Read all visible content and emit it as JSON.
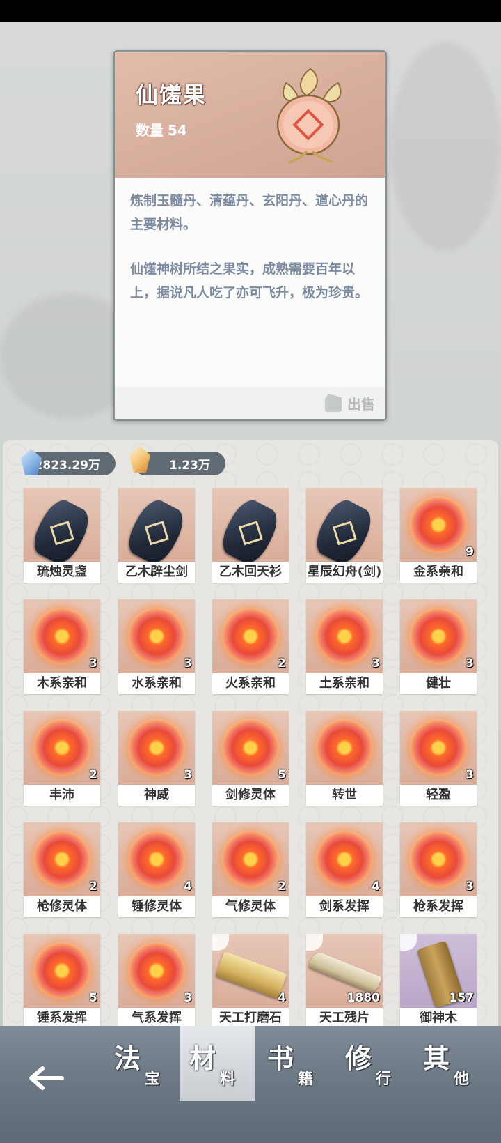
{
  "item_detail": {
    "name": "仙馐果",
    "quantity_label": "数量",
    "quantity_value": "54",
    "description_usage": "炼制玉髓丹、清蕴丹、玄阳丹、道心丹的主要材料。",
    "description_lore": "仙馐神树所结之果实，成熟需要百年以上，据说凡人吃了亦可飞升，极为珍贵。",
    "sell_label": "出售"
  },
  "currencies": [
    {
      "icon": "blue-crystal-icon",
      "value": "2823.29万",
      "color": "#8fb8e8"
    },
    {
      "icon": "gold-crystal-icon",
      "value": "1.23万",
      "color": "#f3c77a"
    }
  ],
  "inventory": [
    {
      "label": "琉烛灵盏",
      "icon": "black-rune-stone-icon",
      "count": ""
    },
    {
      "label": "乙木辟尘剑",
      "icon": "black-rune-stone-icon",
      "count": ""
    },
    {
      "label": "乙木回天衫",
      "icon": "black-rune-stone-icon",
      "count": ""
    },
    {
      "label": "星辰幻舟(剑)",
      "icon": "black-rune-stone-icon",
      "count": ""
    },
    {
      "label": "金系亲和",
      "icon": "fire-orb-icon",
      "count": "9"
    },
    {
      "label": "木系亲和",
      "icon": "fire-orb-icon",
      "count": "3"
    },
    {
      "label": "水系亲和",
      "icon": "fire-orb-icon",
      "count": "3"
    },
    {
      "label": "火系亲和",
      "icon": "fire-orb-icon",
      "count": "2"
    },
    {
      "label": "土系亲和",
      "icon": "fire-orb-icon",
      "count": "3"
    },
    {
      "label": "健壮",
      "icon": "fire-orb-icon",
      "count": "3"
    },
    {
      "label": "丰沛",
      "icon": "fire-orb-icon",
      "count": "2"
    },
    {
      "label": "神威",
      "icon": "fire-orb-icon",
      "count": "3"
    },
    {
      "label": "剑修灵体",
      "icon": "fire-orb-icon",
      "count": "5"
    },
    {
      "label": "转世",
      "icon": "fire-orb-icon",
      "count": ""
    },
    {
      "label": "轻盈",
      "icon": "fire-orb-icon",
      "count": "3"
    },
    {
      "label": "枪修灵体",
      "icon": "fire-orb-icon",
      "count": "2"
    },
    {
      "label": "锤修灵体",
      "icon": "fire-orb-icon",
      "count": "4"
    },
    {
      "label": "气修灵体",
      "icon": "fire-orb-icon",
      "count": "2"
    },
    {
      "label": "剑系发挥",
      "icon": "fire-orb-icon",
      "count": "4"
    },
    {
      "label": "枪系发挥",
      "icon": "fire-orb-icon",
      "count": "3"
    },
    {
      "label": "锤系发挥",
      "icon": "fire-orb-icon",
      "count": "5"
    },
    {
      "label": "气系发挥",
      "icon": "fire-orb-icon",
      "count": "3"
    },
    {
      "label": "天工打磨石",
      "icon": "gold-whetstone-icon",
      "count": "4"
    },
    {
      "label": "天工残片",
      "icon": "bone-shard-icon",
      "count": "1880"
    },
    {
      "label": "御神木",
      "icon": "divine-wood-icon",
      "count": "157"
    }
  ],
  "nav": {
    "back_icon": "back-arrow-icon",
    "tabs": [
      {
        "main": "法",
        "sub": "宝",
        "active": false
      },
      {
        "main": "材",
        "sub": "料",
        "active": true
      },
      {
        "main": "书",
        "sub": "籍",
        "active": false
      },
      {
        "main": "修",
        "sub": "行",
        "active": false
      },
      {
        "main": "其",
        "sub": "他",
        "active": false
      }
    ]
  }
}
